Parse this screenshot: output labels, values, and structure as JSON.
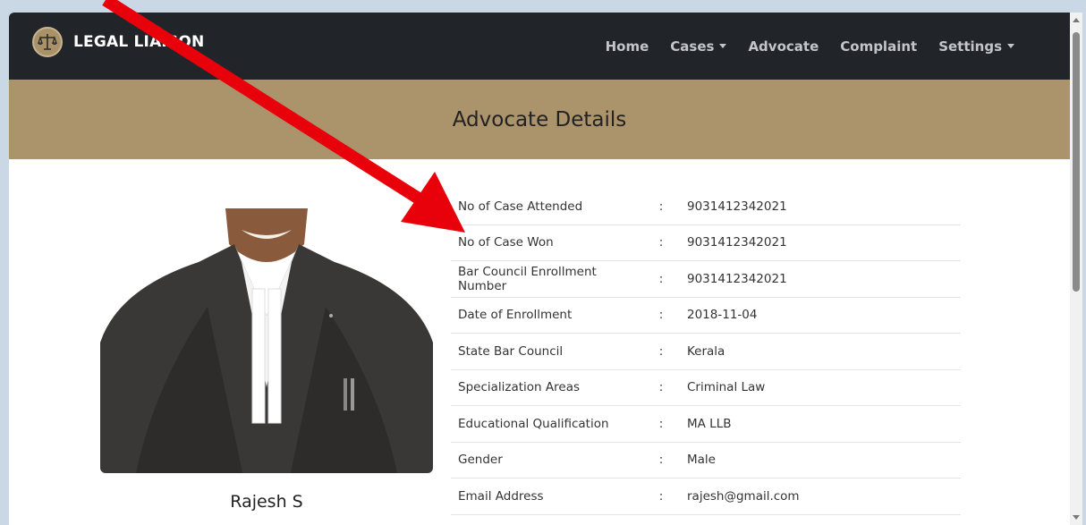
{
  "navbar": {
    "brand": "LEGAL LIAISON",
    "brand_logo_icon": "scales-of-justice-icon",
    "links": [
      {
        "label": "Home",
        "dropdown": false
      },
      {
        "label": "Cases",
        "dropdown": true
      },
      {
        "label": "Advocate",
        "dropdown": false
      },
      {
        "label": "Complaint",
        "dropdown": false
      },
      {
        "label": "Settings",
        "dropdown": true
      }
    ]
  },
  "banner": {
    "title": "Advocate Details"
  },
  "profile": {
    "name": "Rajesh S"
  },
  "details": [
    {
      "label": "No of Case Attended",
      "value": "9031412342021"
    },
    {
      "label": "No of Case Won",
      "value": "9031412342021"
    },
    {
      "label": "Bar Council Enrollment Number",
      "value": "9031412342021"
    },
    {
      "label": "Date of Enrollment",
      "value": "2018-11-04"
    },
    {
      "label": "State Bar Council",
      "value": "Kerala"
    },
    {
      "label": "Specialization Areas",
      "value": "Criminal Law"
    },
    {
      "label": "Educational Qualification",
      "value": "MA LLB"
    },
    {
      "label": "Gender",
      "value": "Male"
    },
    {
      "label": "Email Address",
      "value": "rajesh@gmail.com"
    }
  ],
  "separator": ":",
  "colors": {
    "navbar": "#212529",
    "banner": "#ab936b",
    "annotation_arrow": "#e8000b"
  }
}
